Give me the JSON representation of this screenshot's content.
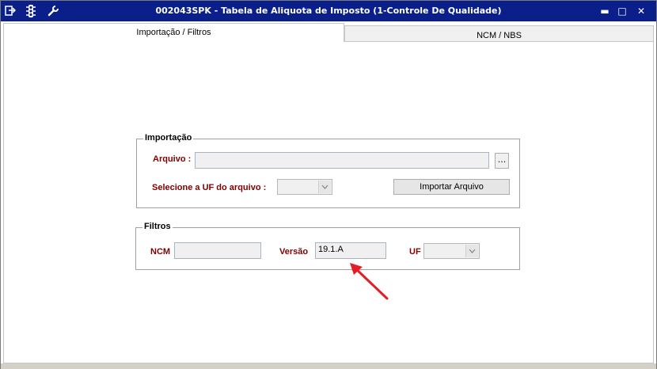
{
  "window": {
    "title": "002043SPK - Tabela de Aliquota de Imposto (1-Controle De Qualidade)",
    "titlebar_color": "#0a1f8a",
    "left_icons": [
      "export-icon",
      "traffic-light-icon",
      "wrench-icon"
    ],
    "minimize_label": "▬",
    "maximize_label": "□",
    "close_label": "✕"
  },
  "tabs": [
    {
      "label": "Importação / Filtros",
      "active": true
    },
    {
      "label": "NCM / NBS",
      "active": false
    }
  ],
  "importacao": {
    "legend": "Importação",
    "arquivo_label": "Arquivo :",
    "arquivo_value": "",
    "browse_label": "...",
    "uf_label": "Selecione a UF do arquivo :",
    "uf_value": "",
    "import_button": "Importar Arquivo"
  },
  "filtros": {
    "legend": "Filtros",
    "ncm_label": "NCM",
    "ncm_value": "",
    "versao_label": "Versão",
    "versao_value": "19.1.A",
    "uf_label": "UF",
    "uf_value": ""
  },
  "annotation": {
    "arrow_color": "#e31e24",
    "arrow_icon": "red-arrow-icon"
  }
}
